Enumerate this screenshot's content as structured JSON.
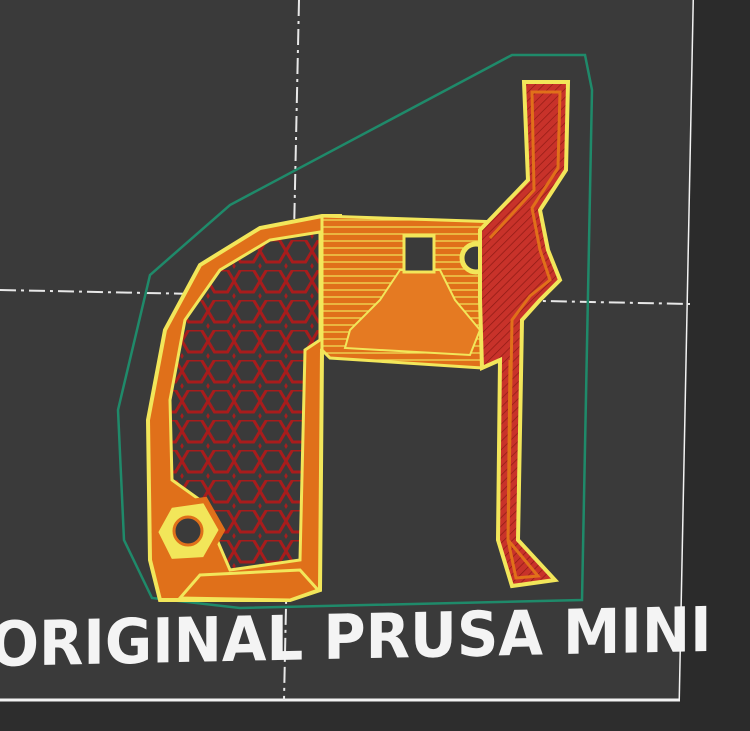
{
  "app": "PrusaSlicer preview",
  "bed": {
    "label": "ORIGINAL PRUSA MINI"
  },
  "colors": {
    "background": "#2d2d2d",
    "bed_surface": "#3a3a3a",
    "bed_edge": "#f2f2f2",
    "axis_line": "#e8e8e8",
    "skirt": "#1f8a6a",
    "perimeter_outer": "#e0701a",
    "perimeter_inner": "#f2e65a",
    "infill": "#b81f1f",
    "solid_infill": "#cf3a2a"
  },
  "icons": {
    "hex_nut_pocket": "hexagon-icon",
    "round_hole": "circle-icon"
  }
}
